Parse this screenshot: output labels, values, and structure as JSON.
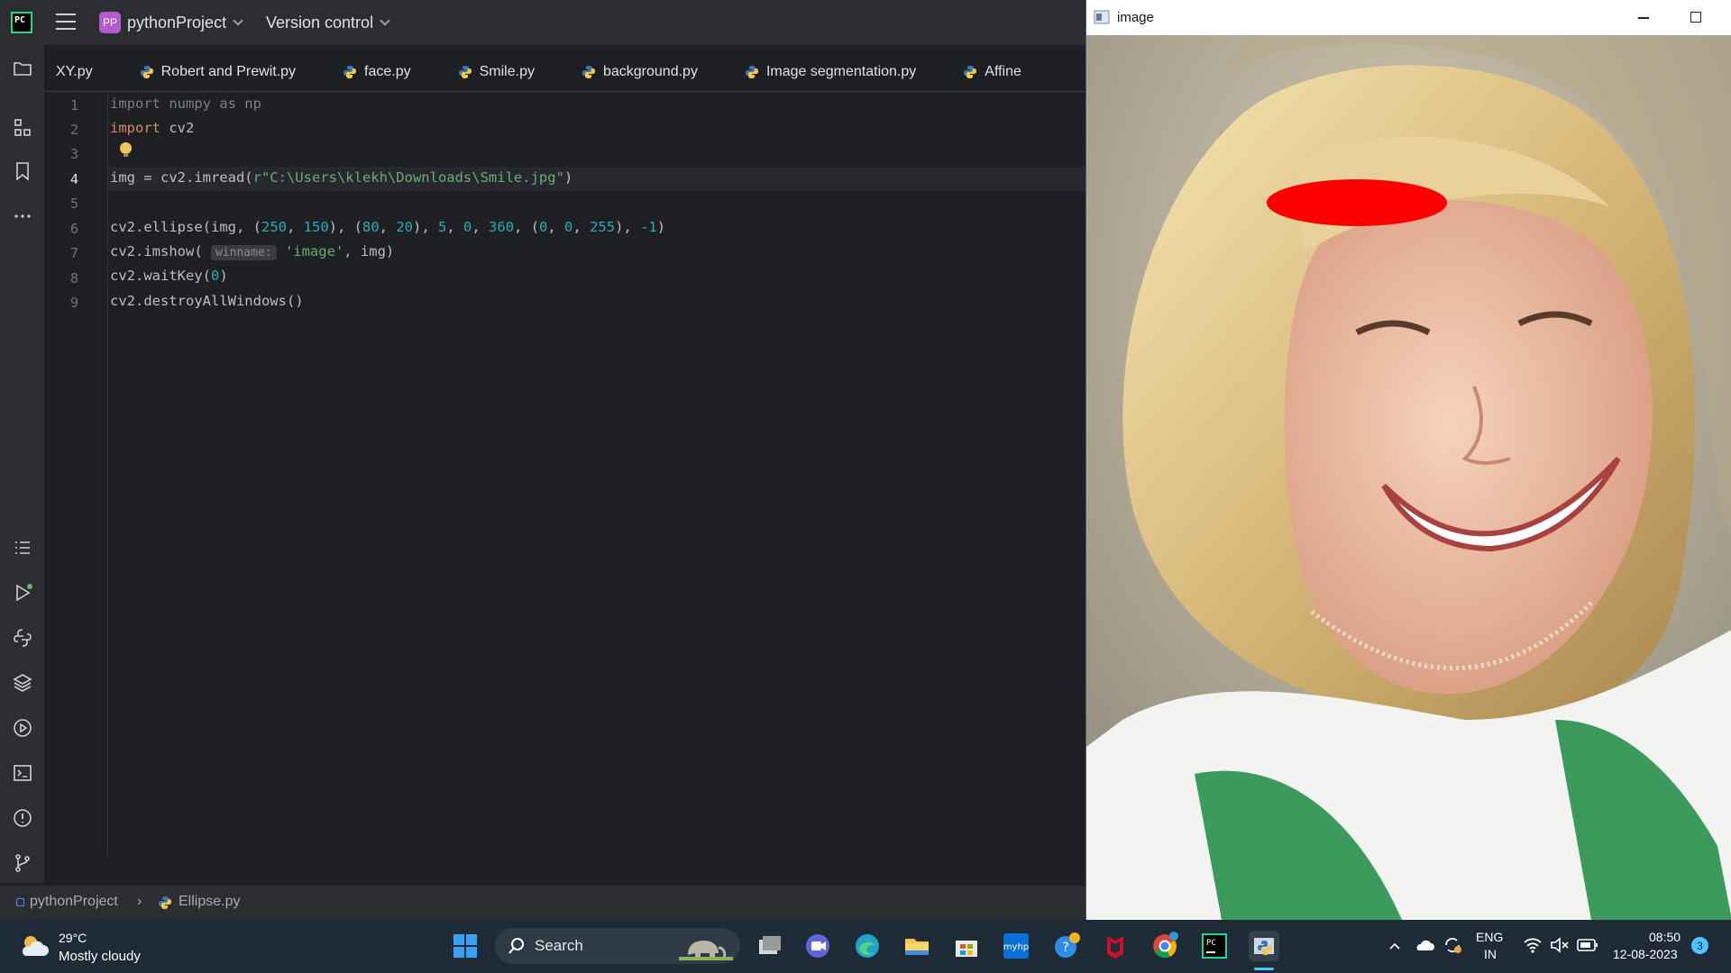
{
  "titlebar": {
    "logo_text": "PC",
    "project_badge": "PP",
    "project_name": "pythonProject",
    "version_control": "Version control"
  },
  "tabs": [
    {
      "label": "XY.py"
    },
    {
      "label": "Robert and Prewit.py"
    },
    {
      "label": "face.py"
    },
    {
      "label": "Smile.py"
    },
    {
      "label": "background.py"
    },
    {
      "label": "Image segmentation.py"
    },
    {
      "label": "Affine"
    }
  ],
  "editor": {
    "line_numbers": [
      "1",
      "2",
      "3",
      "4",
      "5",
      "6",
      "7",
      "8",
      "9"
    ],
    "line1": {
      "a": "import numpy as np"
    },
    "line2": {
      "kw": "import",
      "rest": " cv2"
    },
    "line4": {
      "a": "img = cv2.imread(",
      "str": "r\"C:\\Users\\klekh\\Downloads\\Smile.jpg\"",
      "b": ")"
    },
    "line6": {
      "a": "cv2.ellipse(img, (",
      "n1": "250",
      "s1": ", ",
      "n2": "150",
      "s2": "), (",
      "n3": "80",
      "s3": ", ",
      "n4": "20",
      "s4": "), ",
      "n5": "5",
      "s5": ", ",
      "n6": "0",
      "s6": ", ",
      "n7": "360",
      "s7": ", (",
      "n8": "0",
      "s8": ", ",
      "n9": "0",
      "s9": ", ",
      "n10": "255",
      "s10": "), ",
      "n11": "-1",
      "s11": ")"
    },
    "line7": {
      "a": "cv2.imshow( ",
      "hint": "winname:",
      "str": " 'image'",
      "b": ", img)"
    },
    "line8": {
      "a": "cv2.waitKey(",
      "num": "0",
      "b": ")"
    },
    "line9": {
      "a": "cv2.destroyAllWindows()"
    }
  },
  "statusbar": {
    "project": "pythonProject",
    "file": "Ellipse.py"
  },
  "image_window": {
    "title": "image",
    "ellipse_color": "#ff0000"
  },
  "taskbar": {
    "weather_temp": "29°C",
    "weather_desc": "Mostly cloudy",
    "search_label": "Search",
    "lang_top": "ENG",
    "lang_bottom": "IN",
    "time": "08:50",
    "date": "12-08-2023",
    "notif_count": "3"
  },
  "colors": {
    "ide_bg": "#1e1f22",
    "keyword": "#cf8e6d",
    "string": "#6aab73",
    "number": "#2aacb8",
    "taskbar_bg": "#1f2a37"
  }
}
